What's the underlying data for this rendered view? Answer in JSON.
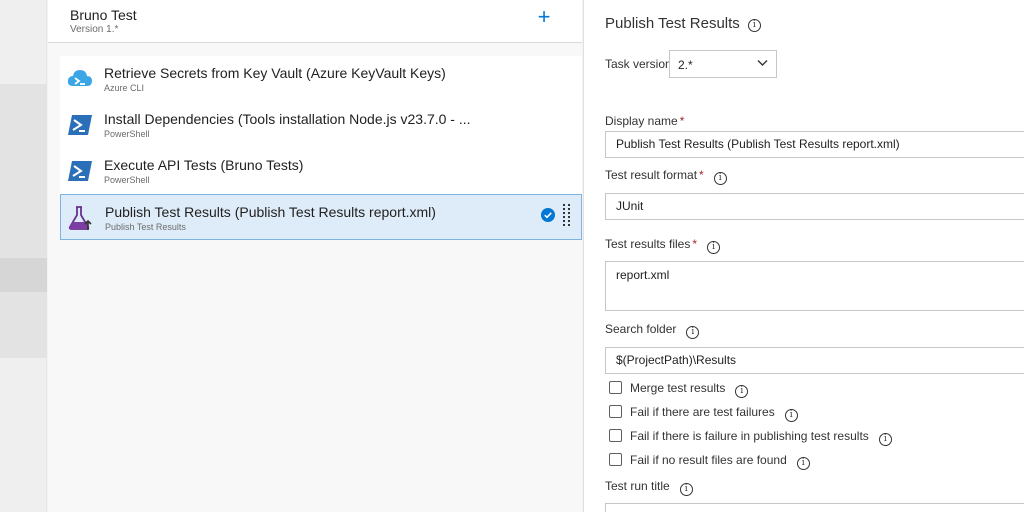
{
  "pipeline": {
    "title": "Bruno Test",
    "version": "Version 1.*",
    "add_symbol": "+"
  },
  "tasks": [
    {
      "name": "Retrieve Secrets from Key Vault (Azure KeyVault Keys)",
      "subtitle": "Azure CLI",
      "icon": "azure-cli-icon"
    },
    {
      "name": "Install Dependencies (Tools installation Node.js v23.7.0 - ...",
      "subtitle": "PowerShell",
      "icon": "powershell-icon"
    },
    {
      "name": "Execute API Tests (Bruno Tests)",
      "subtitle": "PowerShell",
      "icon": "powershell-icon"
    },
    {
      "name": "Publish Test Results (Publish Test Results report.xml)",
      "subtitle": "Publish Test Results",
      "icon": "publish-test-results-icon",
      "selected": true
    }
  ],
  "panel": {
    "title": "Publish Test Results",
    "task_version_label": "Task version",
    "task_version_value": "2.*",
    "display_name_label": "Display name",
    "display_name_value": "Publish Test Results (Publish Test Results report.xml)",
    "format_label": "Test result format",
    "format_value": "JUnit",
    "files_label": "Test results files",
    "files_value": "report.xml",
    "search_folder_label": "Search folder",
    "search_folder_value": "$(ProjectPath)\\Results",
    "checkboxes": [
      {
        "label": "Merge test results",
        "checked": false
      },
      {
        "label": "Fail if there are test failures",
        "checked": false
      },
      {
        "label": "Fail if there is failure in publishing test results",
        "checked": false
      },
      {
        "label": "Fail if no result files are found",
        "checked": false
      }
    ],
    "run_title_label": "Test run title",
    "required_mark": "*",
    "info_glyph": "i"
  },
  "colors": {
    "accent": "#0078d4",
    "selected_bg": "#deecf9",
    "required": "#a4262c"
  }
}
